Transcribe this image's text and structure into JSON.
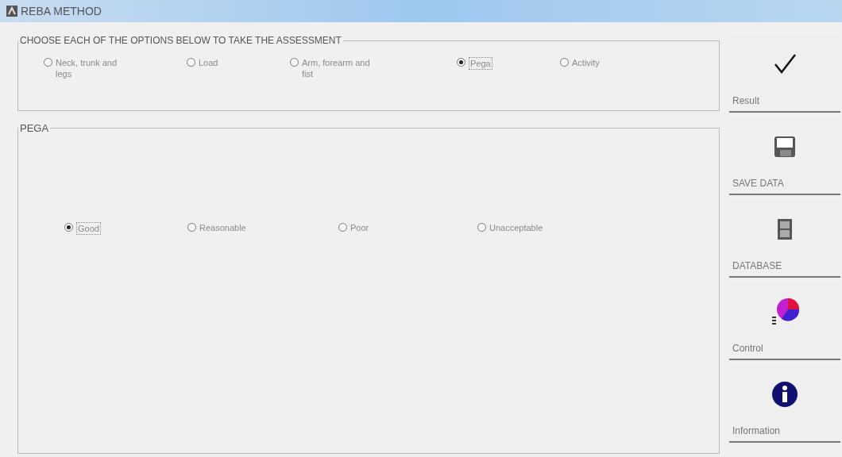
{
  "window": {
    "title": "REBA METHOD"
  },
  "options_group": {
    "title": "CHOOSE EACH OF THE OPTIONS BELOW TO TAKE THE ASSESSMENT",
    "options": [
      {
        "label": "Neck, trunk and legs",
        "selected": false
      },
      {
        "label": "Load",
        "selected": false
      },
      {
        "label": "Arm, forearm and fist",
        "selected": false
      },
      {
        "label": "Pega",
        "selected": true
      },
      {
        "label": "Activity",
        "selected": false
      }
    ]
  },
  "pega_group": {
    "title": "PEGA",
    "options": [
      {
        "label": "Good",
        "selected": true
      },
      {
        "label": "Reasonable",
        "selected": false
      },
      {
        "label": "Poor",
        "selected": false
      },
      {
        "label": "Unacceptable",
        "selected": false
      }
    ]
  },
  "side_buttons": [
    {
      "kind": "check",
      "label": "Result"
    },
    {
      "kind": "save",
      "label": "SAVE DATA"
    },
    {
      "kind": "cabinet",
      "label": "DATABASE"
    },
    {
      "kind": "chart",
      "label": "Control"
    },
    {
      "kind": "info",
      "label": "Information"
    }
  ]
}
